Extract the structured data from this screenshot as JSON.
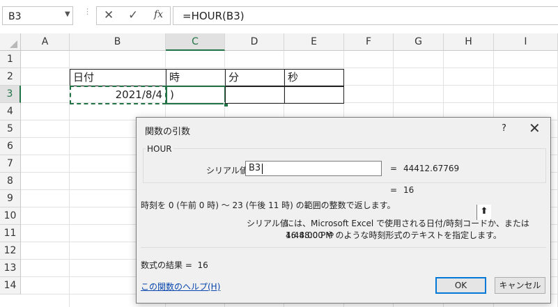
{
  "formula_bar": {
    "name_box": "B3",
    "cancel_icon": "✕",
    "enter_icon": "✓",
    "fx_icon": "fx",
    "formula": "=HOUR(B3)"
  },
  "grid": {
    "columns": [
      "A",
      "B",
      "C",
      "D",
      "E",
      "F",
      "G",
      "H",
      "I"
    ],
    "rows": [
      "1",
      "2",
      "3",
      "4",
      "5",
      "6",
      "7",
      "8",
      "9",
      "10",
      "11",
      "12",
      "13",
      "14"
    ],
    "active_column": "C",
    "active_row": "3",
    "cells": {
      "B2": "日付",
      "C2": "時",
      "D2": "分",
      "E2": "秒",
      "B3": "2021/8/4",
      "C3": ")"
    }
  },
  "dialog": {
    "title": "関数の引数",
    "help_button": "?",
    "close_button": "✕",
    "function_name": "HOUR",
    "argument_label": "シリアル値",
    "argument_value": "B3",
    "argument_eq": "=",
    "argument_result": "44412.67769",
    "result_eq": "=",
    "result_value": "16",
    "description": "時刻を 0 (午前 0 時) ～ 23 (午後 11 時) の範囲の整数で返します。",
    "argument_description_name": "シリアル値",
    "argument_description_line1": "には、Microsoft Excel で使用される日付/時刻コードか、または 16:48:00 や",
    "argument_description_line2": "4:48:00 PM のような時刻形式のテキストを指定します。",
    "formula_result_label": "数式の結果 =",
    "formula_result_value": "16",
    "help_link": "この関数のヘルプ(H)",
    "ok_button": "OK",
    "cancel_button": "キャンセル"
  },
  "colors": {
    "accent_green": "#217346",
    "link_blue": "#0645ad",
    "default_button_border": "#0078d7"
  }
}
